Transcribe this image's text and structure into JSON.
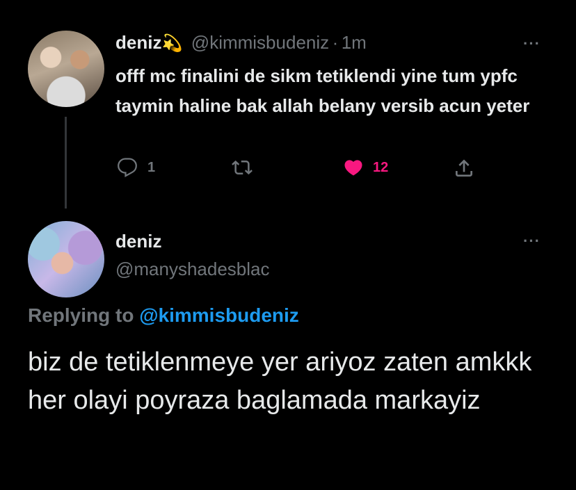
{
  "tweet": {
    "author_name": "deniz",
    "author_emoji": "💫",
    "handle": "@kimmisbudeniz",
    "separator": "·",
    "time": "1m",
    "more": "···",
    "text": "offf mc finalini de sikm tetiklendi yine tum ypfc taymin haline bak allah belany versib acun yeter",
    "reply_count": "1",
    "like_count": "12",
    "icons": [
      "reply-icon",
      "retweet-icon",
      "heart-icon",
      "share-icon"
    ],
    "like_color": "#f91880"
  },
  "reply": {
    "author_name": "deniz",
    "handle": "@manyshadesblac",
    "more": "···",
    "replying_label": "Replying to",
    "replying_to": "@kimmisbudeniz",
    "text": "biz de tetiklenmeye yer ariyoz zaten amkkk her olayi poyraza baglamada markayiz"
  },
  "colors": {
    "background": "#000000",
    "text": "#e7e9ea",
    "muted": "#71767b",
    "link": "#1d9bf0"
  }
}
